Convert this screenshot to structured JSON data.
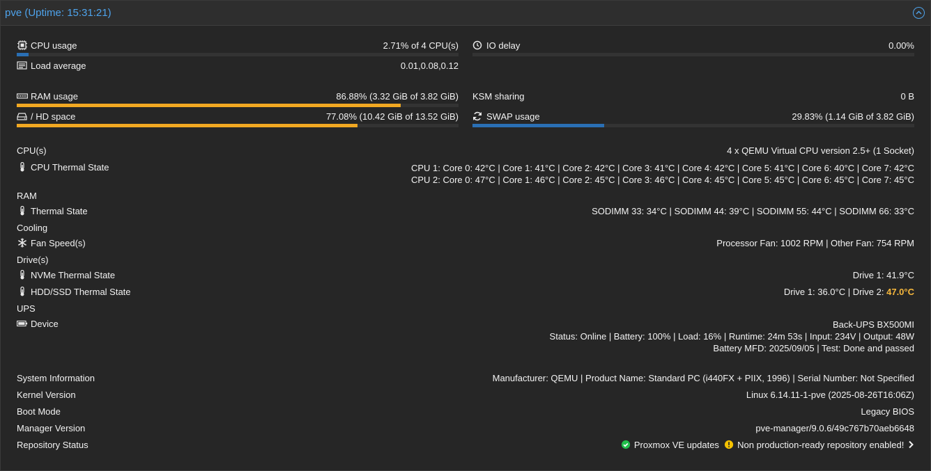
{
  "header": {
    "title": "pve (Uptime: 15:31:21)"
  },
  "stats": {
    "cpu": {
      "label": "CPU usage",
      "value": "2.71% of 4 CPU(s)",
      "percent": 2.71
    },
    "io_delay": {
      "label": "IO delay",
      "value": "0.00%",
      "percent": 0
    },
    "load": {
      "label": "Load average",
      "value": "0.01,0.08,0.12"
    },
    "ram": {
      "label": "RAM usage",
      "value": "86.88% (3.32 GiB of 3.82 GiB)",
      "percent": 86.88
    },
    "ksm": {
      "label": "KSM sharing",
      "value": "0 B"
    },
    "hd": {
      "label": "/ HD space",
      "value": "77.08% (10.42 GiB of 13.52 GiB)",
      "percent": 77.08
    },
    "swap": {
      "label": "SWAP usage",
      "value": "29.83% (1.14 GiB of 3.82 GiB)",
      "percent": 29.83
    }
  },
  "sensors": {
    "cpus_heading": "CPU(s)",
    "cpus_value": "4 x QEMU Virtual CPU version 2.5+ (1 Socket)",
    "cpu_thermal_label": "CPU Thermal State",
    "cpu_thermal_line1": "CPU 1: Core 0: 42°C | Core 1: 41°C | Core 2: 42°C | Core 3: 41°C | Core 4: 42°C | Core 5: 41°C | Core 6: 40°C | Core 7: 42°C",
    "cpu_thermal_line2": "CPU 2: Core 0: 47°C | Core 1: 46°C | Core 2: 45°C | Core 3: 46°C | Core 4: 45°C | Core 5: 45°C | Core 6: 45°C | Core 7: 45°C",
    "ram_heading": "RAM",
    "ram_thermal_label": "Thermal State",
    "ram_thermal_value": "SODIMM 33: 34°C | SODIMM 44: 39°C | SODIMM 55: 44°C | SODIMM 66: 33°C",
    "cooling_heading": "Cooling",
    "fan_label": "Fan Speed(s)",
    "fan_value": "Processor Fan: 1002 RPM | Other Fan: 754 RPM",
    "drives_heading": "Drive(s)",
    "nvme_label": "NVMe Thermal State",
    "nvme_value": "Drive 1: 41.9°C",
    "hdd_label": "HDD/SSD Thermal State",
    "hdd_value_normal": "Drive 1: 36.0°C | Drive 2: ",
    "hdd_value_warn": "47.0°C",
    "ups_heading": "UPS",
    "ups_device_label": "Device",
    "ups_line1": "Back-UPS BX500MI",
    "ups_line2": "Status: Online | Battery: 100% | Load: 16% | Runtime: 24m 53s | Input: 234V | Output: 48W",
    "ups_line3": "Battery MFD: 2025/09/05 | Test: Done and passed"
  },
  "info": {
    "sysinfo_label": "System Information",
    "sysinfo_value": "Manufacturer: QEMU | Product Name: Standard PC (i440FX + PIIX, 1996) | Serial Number: Not Specified",
    "kernel_label": "Kernel Version",
    "kernel_value": "Linux 6.14.11-1-pve (2025-08-26T16:06Z)",
    "boot_label": "Boot Mode",
    "boot_value": "Legacy BIOS",
    "manager_label": "Manager Version",
    "manager_value": "pve-manager/9.0.6/49c767b70aeb6648",
    "repo_label": "Repository Status",
    "repo_ok": "Proxmox VE updates",
    "repo_warn": "Non production-ready repository enabled!"
  },
  "colors": {
    "accent": "#4ea3ec",
    "bar_blue": "#2a6fb4",
    "bar_amber": "#f1a822",
    "warn": "#f6b73c",
    "ok": "#21bf4b"
  }
}
